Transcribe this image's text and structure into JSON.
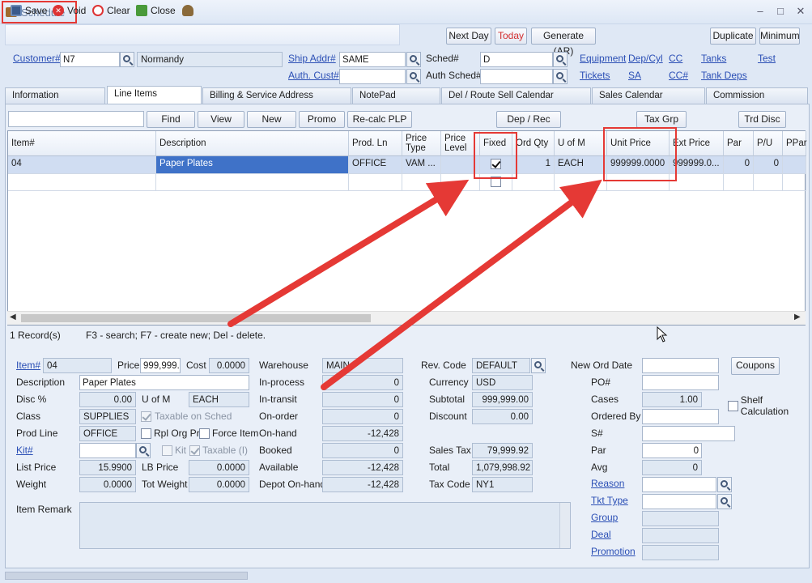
{
  "window": {
    "title": "Schedule"
  },
  "toolbar": {
    "save": "Save",
    "void": "Void",
    "clear": "Clear",
    "close": "Close"
  },
  "actions": {
    "next_day": "Next Day",
    "today": "Today",
    "generate": "Generate (AR)",
    "duplicate": "Duplicate",
    "minimum": "Minimum"
  },
  "header": {
    "customer_label": "Customer#",
    "customer_id": "N7",
    "customer_name": "Normandy",
    "ship_addr_label": "Ship Addr#",
    "ship_addr": "SAME",
    "auth_cust_label": "Auth. Cust#",
    "auth_cust": "",
    "sched_label": "Sched#",
    "sched": "D",
    "auth_sched_label": "Auth Sched#",
    "auth_sched": "",
    "links": {
      "equipment": "Equipment",
      "dep_cyl": "Dep/Cyl",
      "cc": "CC",
      "tanks": "Tanks",
      "test": "Test",
      "tickets": "Tickets",
      "sa": "SA",
      "cc_num": "CC#",
      "tank_deps": "Tank Deps"
    }
  },
  "tabs": [
    "Information",
    "Line Items",
    "Billing & Service Address",
    "NotePad",
    "Del / Route Sell Calendar",
    "Sales Calendar",
    "Commission"
  ],
  "grid_toolbar": {
    "search_value": "",
    "find": "Find",
    "view": "View",
    "new": "New",
    "promo": "Promo",
    "recalc": "Re-calc PLP",
    "dep_rec": "Dep / Rec",
    "tax_grp": "Tax Grp",
    "trd_disc": "Trd Disc"
  },
  "grid": {
    "columns": [
      "Item#",
      "Description",
      "Prod. Ln",
      "Price Type",
      "Price Level",
      "Fixed",
      "Ord Qty",
      "U of M",
      "Unit Price",
      "Ext Price",
      "Par",
      "P/U",
      "PPar"
    ],
    "rows": [
      {
        "item": "04",
        "description": "Paper Plates",
        "prod_ln": "OFFICE",
        "price_type": "VAM ...",
        "price_level": "",
        "fixed": true,
        "ord_qty": "1",
        "uom": "EACH",
        "unit_price": "999999.0000",
        "ext_price": "999999.0...",
        "par": "0",
        "pu": "0",
        "ppar": ""
      }
    ],
    "status": "1 Record(s)",
    "hint": "F3 - search; F7 - create new; Del - delete."
  },
  "detail": {
    "item_label": "Item#",
    "item": "04",
    "price_label": "Price",
    "price": "999,999.",
    "cost_label": "Cost",
    "cost": "0.0000",
    "description_label": "Description",
    "description": "Paper Plates",
    "disc_label": "Disc %",
    "disc": "0.00",
    "uom_label": "U of M",
    "uom": "EACH",
    "class_label": "Class",
    "class": "SUPPLIES",
    "taxable_on_sched": "Taxable on Sched",
    "prod_line_label": "Prod Line",
    "prod_line": "OFFICE",
    "rpl_org_prc": "Rpl Org Prc",
    "force_item": "Force Item",
    "kit_label": "Kit#",
    "kit": "",
    "kit_cb": "Kit",
    "taxable_i": "Taxable (I)",
    "list_price_label": "List Price",
    "list_price": "15.9900",
    "lb_price_label": "LB Price",
    "lb_price": "0.0000",
    "weight_label": "Weight",
    "weight": "0.0000",
    "tot_weight_label": "Tot Weight",
    "tot_weight": "0.0000",
    "warehouse_label": "Warehouse",
    "warehouse": "MAIN",
    "in_process_label": "In-process",
    "in_process": "0",
    "in_transit_label": "In-transit",
    "in_transit": "0",
    "on_order_label": "On-order",
    "on_order": "0",
    "on_hand_label": "On-hand",
    "on_hand": "-12,428",
    "booked_label": "Booked",
    "booked": "0",
    "available_label": "Available",
    "available": "-12,428",
    "depot_label": "Depot On-hand",
    "depot": "-12,428",
    "rev_code_label": "Rev. Code",
    "rev_code": "DEFAULT",
    "currency_label": "Currency",
    "currency": "USD",
    "subtotal_label": "Subtotal",
    "subtotal": "999,999.00",
    "discount_label": "Discount",
    "discount": "0.00",
    "sales_tax_label": "Sales Tax",
    "sales_tax": "79,999.92",
    "total_label": "Total",
    "total": "1,079,998.92",
    "tax_code_label": "Tax Code",
    "tax_code": "NY1",
    "new_ord_date_label": "New Ord Date",
    "new_ord_date": "",
    "coupons": "Coupons",
    "po_label": "PO#",
    "po": "",
    "cases_label": "Cases",
    "cases": "1.00",
    "shelf_calc": "Shelf Calculation",
    "ordered_by_label": "Ordered By",
    "ordered_by": "",
    "s_label": "S#",
    "s": "",
    "par_label": "Par",
    "par": "0",
    "avg_label": "Avg",
    "avg": "0",
    "reason_label": "Reason",
    "reason": "",
    "tkt_type_label": "Tkt Type",
    "tkt_type": "",
    "group_label": "Group",
    "group": "",
    "deal_label": "Deal",
    "deal": "",
    "promotion_label": "Promotion",
    "promotion": "",
    "item_remark_label": "Item Remark",
    "item_remark": ""
  },
  "colors": {
    "annotation": "#e53935",
    "selected_cell": "#3f72c8",
    "link": "#2b4fb5",
    "today": "#d32f2f"
  }
}
